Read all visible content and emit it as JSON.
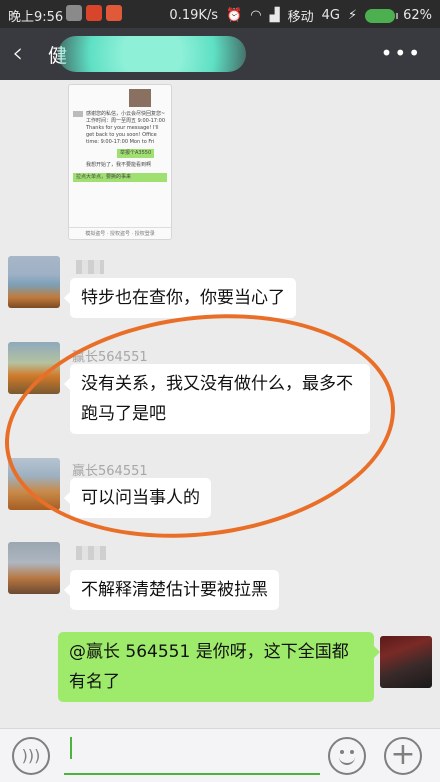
{
  "status_bar": {
    "time": "晚上9:56",
    "speed": "0.19K/s",
    "carrier": "移动",
    "network": "4G",
    "battery": "62%",
    "battery_color": "#4caf50"
  },
  "header": {
    "title": "健",
    "back_icon": "chevron-left-icon",
    "more_icon": "more-dots-icon",
    "background": "#393a3f"
  },
  "screenshot_card": {
    "text_1": "感谢您的私信，小云会尽快回复您~",
    "text_2": "工作时间：周一至周五 9:00-17:00",
    "text_3": "Thanks for your message! I'll get back to you soon! Office time: 9:00-17:00 Mon to Fri",
    "green_1": "举报个A3550",
    "text_4": "我想开始了，我不要能看到啊",
    "green_2": "拉点大单点，要撕的事来",
    "toolbar": "模拟盗号 · 授权盗号 · 授权登录"
  },
  "messages": [
    {
      "sender": "",
      "text": "特步也在查你，你要当心了",
      "direction": "in"
    },
    {
      "sender": "赢长564551",
      "text": "没有关系，我又没有做什么，最多不跑马了是吧",
      "direction": "in"
    },
    {
      "sender": "赢长564551",
      "text": "可以问当事人的",
      "direction": "in"
    },
    {
      "sender": "",
      "text": "不解释清楚估计要被拉黑",
      "direction": "in"
    },
    {
      "sender": "",
      "text": "@赢长 564551 是你呀，这下全国都有名了",
      "direction": "out"
    }
  ],
  "input_bar": {
    "voice_icon": "voice-icon",
    "emoji_icon": "emoji-icon",
    "plus_icon": "plus-icon",
    "value": "",
    "accent": "#4cb43c"
  },
  "colors": {
    "chat_background": "#ebebeb",
    "outgoing_bubble": "#9eea6a",
    "annotation": "#e96f28"
  }
}
